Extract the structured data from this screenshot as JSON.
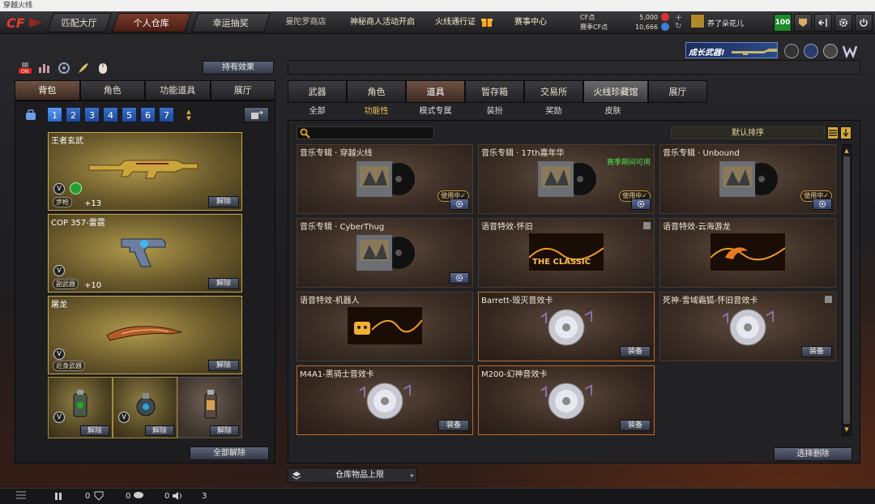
{
  "window": {
    "title": "穿越火线"
  },
  "topnav": {
    "tabs": [
      {
        "label": "匹配大厅",
        "active": false
      },
      {
        "label": "个人仓库",
        "active": true
      },
      {
        "label": "幸运抽奖",
        "active": false
      }
    ],
    "links": [
      "曼陀罗商店",
      "神秘商人活动开启",
      "火线通行证",
      "赛事中心"
    ],
    "currency": {
      "cf_label": "CF点",
      "cf_value": "5,000",
      "season_label": "赛季CF点",
      "season_value": "10,666"
    },
    "user": {
      "nickname": "养了朵花儿",
      "level": "100"
    }
  },
  "banner": {
    "text": "成长武器!"
  },
  "left": {
    "effects_button": "持有效果",
    "tabs": [
      "背包",
      "角色",
      "功能道具",
      "展厅"
    ],
    "pages": [
      "1",
      "2",
      "3",
      "4",
      "5",
      "6",
      "7"
    ],
    "weapons": [
      {
        "name": "王者玄武",
        "slot": "步枪",
        "bonus": "+13",
        "unequip": "解除"
      },
      {
        "name": "COP 357-雷霆",
        "slot": "副武器",
        "bonus": "+10",
        "unequip": "解除"
      },
      {
        "name": "屠龙",
        "slot": "近身武器",
        "bonus": "",
        "unequip": "解除"
      }
    ],
    "small_items": [
      {
        "unequip": "解除"
      },
      {
        "unequip": "解除"
      },
      {
        "unequip": "解除"
      }
    ],
    "unequip_all": "全部解除"
  },
  "right": {
    "tabs": [
      {
        "label": "武器",
        "active": false
      },
      {
        "label": "角色",
        "active": false
      },
      {
        "label": "道具",
        "active": true
      },
      {
        "label": "暂存箱",
        "active": false
      },
      {
        "label": "交易所",
        "active": false
      },
      {
        "label": "火线珍藏馆",
        "active": false
      },
      {
        "label": "展厅",
        "active": false
      }
    ],
    "subtabs": [
      {
        "label": "全部",
        "active": false
      },
      {
        "label": "功能性",
        "active": true
      },
      {
        "label": "模式专属",
        "active": false
      },
      {
        "label": "装扮",
        "active": false
      },
      {
        "label": "奖励",
        "active": false
      },
      {
        "label": "皮肤",
        "active": false
      }
    ],
    "sort_label": "默认排序",
    "items": [
      {
        "name": "音乐专辑 · 穿越火线",
        "status": "使用中✓",
        "action": "gear",
        "type": "album",
        "season": ""
      },
      {
        "name": "音乐专辑 · 17th嘉年华",
        "status": "使用中✓",
        "action": "gear",
        "type": "album",
        "season": "赛季期间可用"
      },
      {
        "name": "音乐专辑 · Unbound",
        "status": "使用中✓",
        "action": "gear",
        "type": "album",
        "season": ""
      },
      {
        "name": "音乐专辑 · CyberThug",
        "status": "",
        "action": "gear",
        "type": "album",
        "season": ""
      },
      {
        "name": "语音特效-怀旧",
        "status": "",
        "action": "",
        "type": "classic",
        "season": "",
        "thumb_text": "THE CLASSIC"
      },
      {
        "name": "语音特效-云海游龙",
        "status": "",
        "action": "",
        "type": "dragon",
        "season": ""
      },
      {
        "name": "语音特效-机器人",
        "status": "",
        "action": "",
        "type": "robot",
        "season": ""
      },
      {
        "name": "Barrett-毁灭音效卡",
        "status": "",
        "action": "装备",
        "type": "disc",
        "season": ""
      },
      {
        "name": "死神-雪域霜狐-怀旧音效卡",
        "status": "",
        "action": "装备",
        "type": "disc",
        "season": ""
      },
      {
        "name": "M4A1-黑骑士音效卡",
        "status": "",
        "action": "装备",
        "type": "disc",
        "season": ""
      },
      {
        "name": "M200-幻神音效卡",
        "status": "",
        "action": "装备",
        "type": "disc",
        "season": ""
      }
    ],
    "delete_button": "选择删除",
    "capacity_label": "仓库物品上限"
  },
  "bottom": {
    "counts": [
      "0",
      "0",
      "0",
      "3"
    ]
  }
}
